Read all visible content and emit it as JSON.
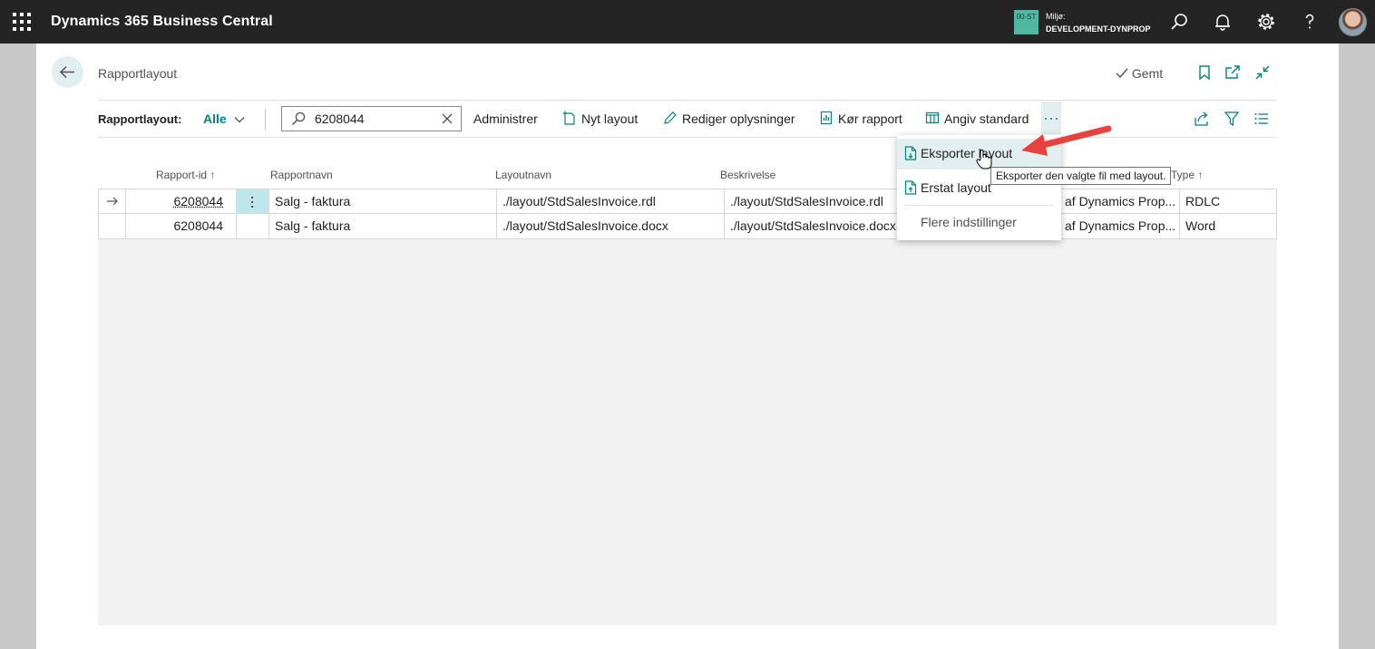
{
  "topbar": {
    "app_title": "Dynamics 365 Business Central",
    "env_badge": "00-ST",
    "env_label": "Miljø:",
    "env_name": "DEVELOPMENT-DYNPROP",
    "icons": [
      "waffle-icon",
      "search-icon",
      "bell-icon",
      "gear-icon",
      "help-icon",
      "avatar"
    ]
  },
  "page": {
    "title": "Rapportlayout",
    "saved_label": "Gemt"
  },
  "actionbar": {
    "view_label": "Rapportlayout:",
    "filter_label": "Alle",
    "search_value": "6208044",
    "administer": "Administrer",
    "new_layout": "Nyt layout",
    "edit_info": "Rediger oplysninger",
    "run_report": "Kør rapport",
    "set_default": "Angiv standard"
  },
  "columns": {
    "report_id": "Rapport-id",
    "report_name": "Rapportnavn",
    "layout_name": "Layoutnavn",
    "description": "Beskrivelse",
    "type": "Type"
  },
  "rows": [
    {
      "report_id": "6208044",
      "report_name": "Salg - faktura",
      "layout_name": "./layout/StdSalesInvoice.rdl",
      "description": "./layout/StdSalesInvoice.rdl",
      "publisher": "af Dynamics Prop...",
      "type": "RDLC"
    },
    {
      "report_id": "6208044",
      "report_name": "Salg - faktura",
      "layout_name": "./layout/StdSalesInvoice.docx",
      "description": "./layout/StdSalesInvoice.docx",
      "publisher": "af Dynamics Prop...",
      "type": "Word"
    }
  ],
  "menu": {
    "export": "Eksporter layout",
    "replace": "Erstat layout",
    "more": "Flere indstillinger"
  },
  "tooltip": "Eksporter den valgte fil med layout.",
  "colors": {
    "accent": "#00857a",
    "topbar": "#242424",
    "selection": "#bfe6ea",
    "arrow": "#e8423f"
  }
}
